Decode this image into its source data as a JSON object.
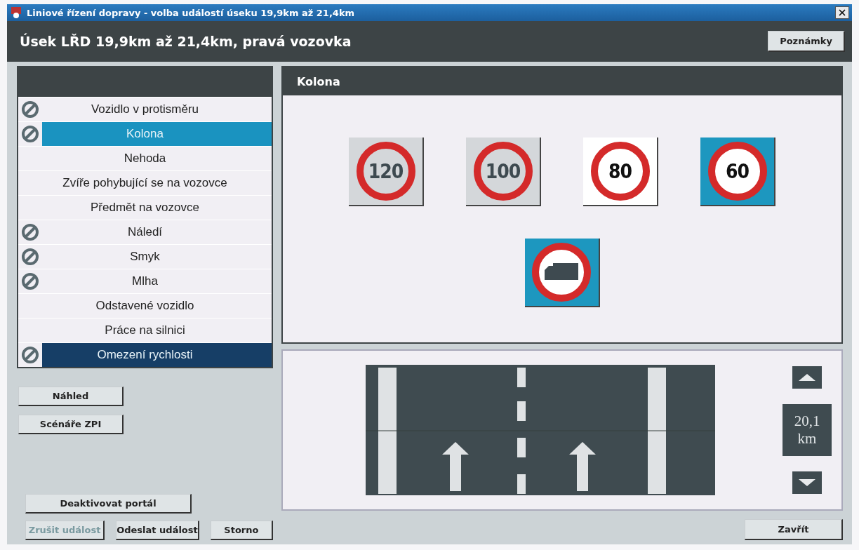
{
  "window": {
    "title": "Liniové řízení dopravy - volba událostí úseku 19,9km až 21,4km"
  },
  "header": {
    "title": "Úsek LŘD 19,9km až 21,4km, pravá vozovka",
    "button": "Poznámky"
  },
  "events": [
    {
      "label": "Vozidlo v protisměru",
      "blocked": true,
      "selected": false,
      "highlighted": false
    },
    {
      "label": "Kolona",
      "blocked": true,
      "selected": true,
      "highlighted": false
    },
    {
      "label": "Nehoda",
      "blocked": false,
      "selected": false,
      "highlighted": false
    },
    {
      "label": "Zvíře pohybující se na vozovce",
      "blocked": false,
      "selected": false,
      "highlighted": false
    },
    {
      "label": "Předmět na vozovce",
      "blocked": false,
      "selected": false,
      "highlighted": false
    },
    {
      "label": "Náledí",
      "blocked": true,
      "selected": false,
      "highlighted": false
    },
    {
      "label": "Smyk",
      "blocked": true,
      "selected": false,
      "highlighted": false
    },
    {
      "label": "Mlha",
      "blocked": true,
      "selected": false,
      "highlighted": false
    },
    {
      "label": "Odstavené vozidlo",
      "blocked": false,
      "selected": false,
      "highlighted": false
    },
    {
      "label": "Práce na silnici",
      "blocked": false,
      "selected": false,
      "highlighted": false
    },
    {
      "label": "Omezení rychlosti",
      "blocked": true,
      "selected": false,
      "highlighted": true
    }
  ],
  "side_buttons": [
    "Náhled",
    "Scénáře ZPI"
  ],
  "detail": {
    "title": "Kolona",
    "signs": [
      {
        "kind": "speed",
        "text": "120",
        "disabled": true,
        "selected": false
      },
      {
        "kind": "speed",
        "text": "100",
        "disabled": true,
        "selected": false
      },
      {
        "kind": "speed",
        "text": "80",
        "disabled": false,
        "selected": false
      },
      {
        "kind": "speed",
        "text": "60",
        "disabled": false,
        "selected": true
      },
      {
        "kind": "no-trucks",
        "disabled": false,
        "selected": true
      }
    ]
  },
  "position": {
    "value": "20,1",
    "unit": "km"
  },
  "bottom_buttons": [
    {
      "label": "Deaktivovat portál",
      "disabled": false
    },
    {
      "label": "Zrušit událost",
      "disabled": true
    },
    {
      "label": "Odeslat událost",
      "disabled": false
    },
    {
      "label": "Storno",
      "disabled": false
    }
  ],
  "close_button": "Zavřít"
}
